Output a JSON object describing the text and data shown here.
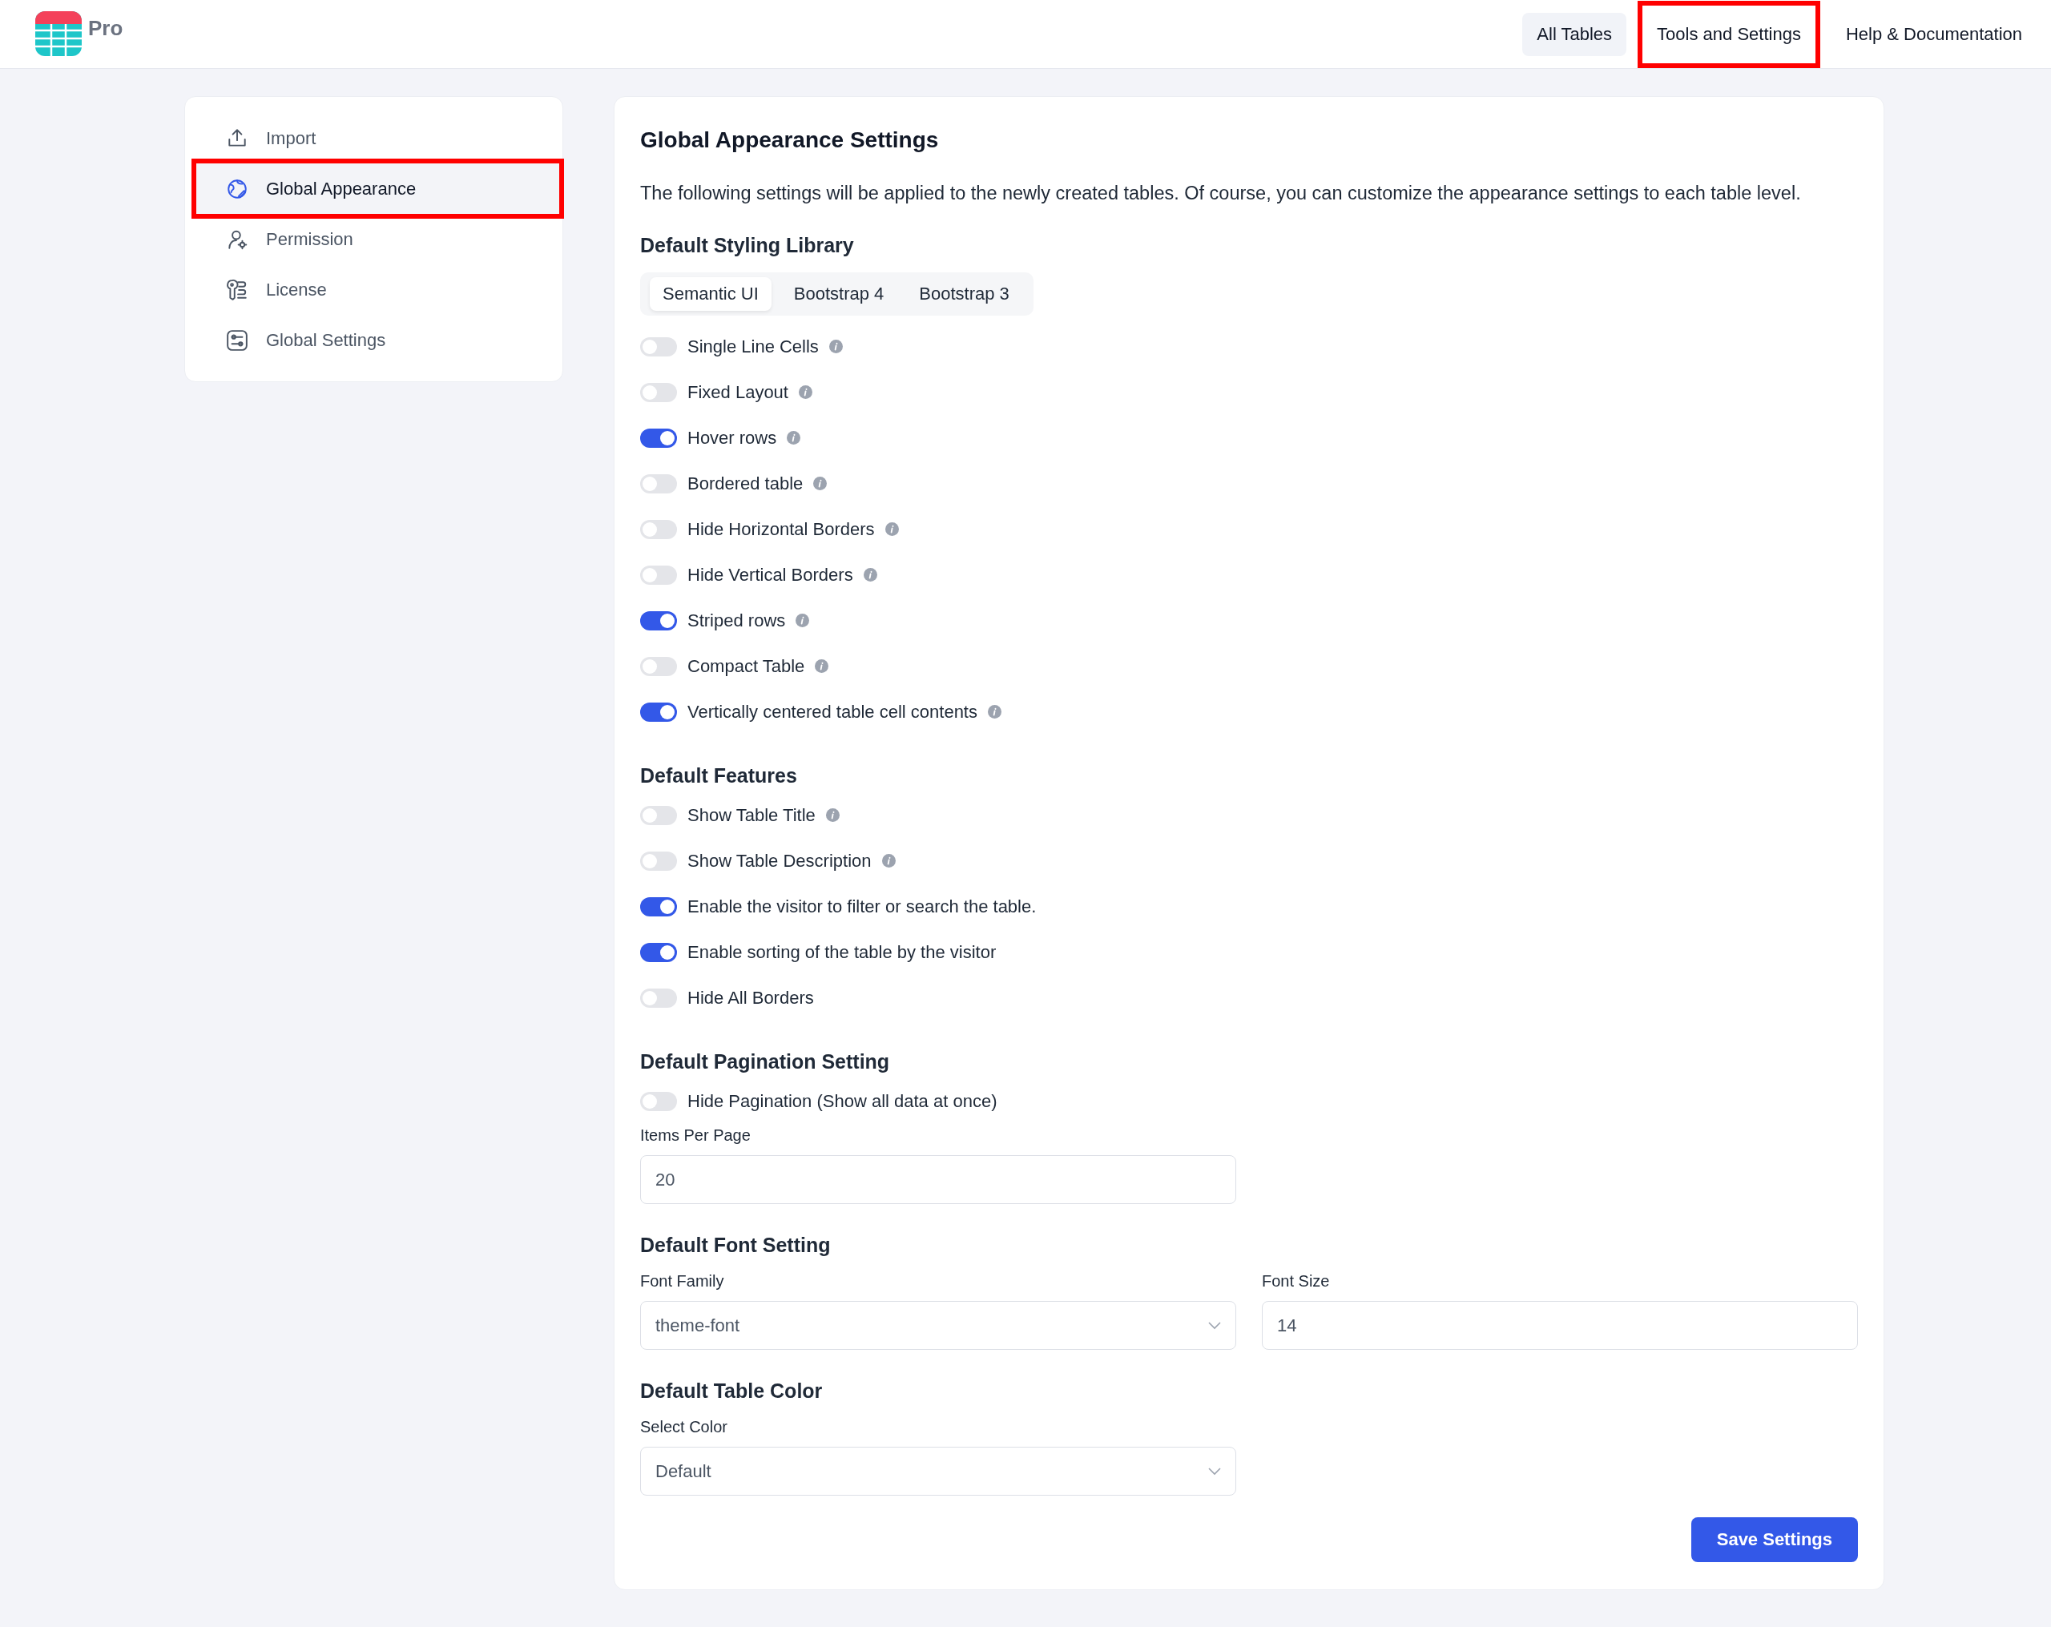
{
  "header": {
    "logo_text": "Pro",
    "nav": [
      {
        "label": "All Tables",
        "selected": true,
        "highlighted": false
      },
      {
        "label": "Tools and Settings",
        "selected": false,
        "highlighted": true
      },
      {
        "label": "Help & Documentation",
        "selected": false,
        "highlighted": false
      }
    ]
  },
  "sidebar": {
    "items": [
      {
        "kind": "import",
        "label": "Import",
        "selected": false,
        "highlighted": false
      },
      {
        "kind": "appearance",
        "label": "Global Appearance",
        "selected": true,
        "highlighted": true
      },
      {
        "kind": "permission",
        "label": "Permission",
        "selected": false,
        "highlighted": false
      },
      {
        "kind": "license",
        "label": "License",
        "selected": false,
        "highlighted": false
      },
      {
        "kind": "settings",
        "label": "Global Settings",
        "selected": false,
        "highlighted": false
      }
    ]
  },
  "main": {
    "title": "Global Appearance Settings",
    "description": "The following settings will be applied to the newly created tables. Of course, you can customize the appearance settings to each table level.",
    "sections": [
      {
        "heading": "Default Styling Library",
        "tabs": [
          {
            "label": "Semantic UI",
            "selected": true
          },
          {
            "label": "Bootstrap 4",
            "selected": false
          },
          {
            "label": "Bootstrap 3",
            "selected": false
          }
        ],
        "toggles": [
          {
            "label": "Single Line Cells",
            "on": false,
            "info": true
          },
          {
            "label": "Fixed Layout",
            "on": false,
            "info": true
          },
          {
            "label": "Hover rows",
            "on": true,
            "info": true
          },
          {
            "label": "Bordered table",
            "on": false,
            "info": true
          },
          {
            "label": "Hide Horizontal Borders",
            "on": false,
            "info": true
          },
          {
            "label": "Hide Vertical Borders",
            "on": false,
            "info": true
          },
          {
            "label": "Striped rows",
            "on": true,
            "info": true
          },
          {
            "label": "Compact Table",
            "on": false,
            "info": true
          },
          {
            "label": "Vertically centered table cell contents",
            "on": true,
            "info": true
          }
        ]
      },
      {
        "heading": "Default Features",
        "toggles": [
          {
            "label": "Show Table Title",
            "on": false,
            "info": true
          },
          {
            "label": "Show Table Description",
            "on": false,
            "info": true
          },
          {
            "label": "Enable the visitor to filter or search the table.",
            "on": true,
            "info": false
          },
          {
            "label": "Enable sorting of the table by the visitor",
            "on": true,
            "info": false
          },
          {
            "label": "Hide All Borders",
            "on": false,
            "info": false
          }
        ]
      },
      {
        "heading": "Default Pagination Setting",
        "toggles": [
          {
            "label": "Hide Pagination (Show all data at once)",
            "on": false,
            "info": false
          }
        ],
        "fields": [
          {
            "kind": "input",
            "label": "Items Per Page",
            "value": "20"
          }
        ]
      },
      {
        "heading": "Default Font Setting",
        "fields": [
          {
            "kind": "select",
            "label": "Font Family",
            "value": "theme-font"
          },
          {
            "kind": "input",
            "label": "Font Size",
            "value": "14"
          }
        ]
      },
      {
        "heading": "Default Table Color",
        "fields": [
          {
            "kind": "select",
            "label": "Select Color",
            "value": "Default"
          }
        ]
      }
    ],
    "save_button": "Save Settings"
  }
}
